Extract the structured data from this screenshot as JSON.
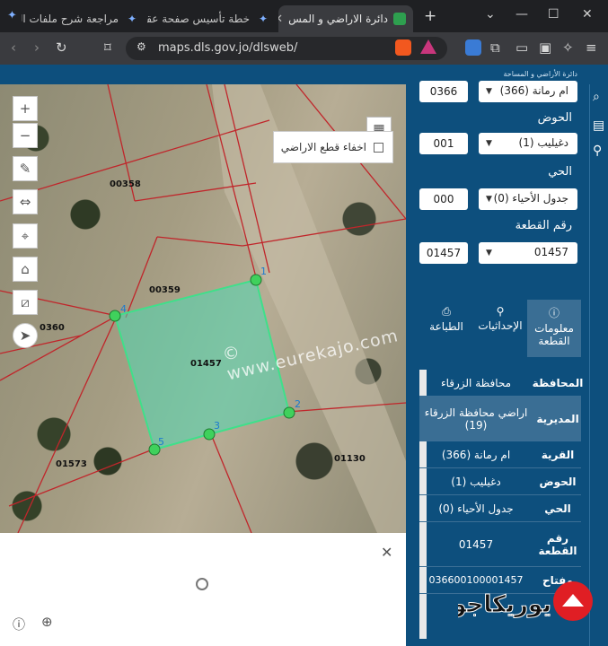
{
  "browser": {
    "tabs": [
      {
        "title": "مراجعة شرح ملفات الدرس",
        "color": "#6aa9ff"
      },
      {
        "title": "خطة تأسيس صفحة عقار",
        "color": "#6aa9ff"
      },
      {
        "title": "دائرة الاراضي و المس",
        "color": "#2e9f4f"
      }
    ],
    "new_tab": "+",
    "url": "maps.dls.gov.jo/dlsweb/"
  },
  "app": {
    "header_text": "دائرة الأراضي و المساحة",
    "map": {
      "hide_parcels_label": "اخفاء قطع الاراضي",
      "parcel_labels": [
        "00358",
        "00359",
        "0360",
        "01457",
        "01573",
        "01130"
      ],
      "vertex_labels": [
        "1",
        "2",
        "3",
        "4",
        "5"
      ],
      "watermark": "© www.eurekajo.com"
    },
    "form": {
      "top_select": "ام رمانة (366)",
      "top_num": "0366",
      "basin_label": "الحوض",
      "basin_select": "دغيليب (1)",
      "basin_num": "001",
      "district_label": "الحي",
      "district_select": "جدول الأحياء (0)",
      "district_num": "000",
      "plot_label": "رقم القطعة",
      "plot_select": "01457",
      "plot_num": "01457"
    },
    "tabs": [
      {
        "label": "معلومات القطعة",
        "icon": "ⓘ"
      },
      {
        "label": "الإحداثيات",
        "icon": "⚲"
      },
      {
        "label": "الطباعة",
        "icon": "⎙"
      }
    ],
    "details": [
      {
        "key": "المحافظة",
        "value": "محافظة الزرقاء"
      },
      {
        "key": "المديرية",
        "value": "اراضي محافظة الزرقاء (19)"
      },
      {
        "key": "القرية",
        "value": "ام رمانة (366)"
      },
      {
        "key": "الحوض",
        "value": "دغيليب (1)"
      },
      {
        "key": "الحي",
        "value": "جدول الأحياء (0)"
      },
      {
        "key": "رقم القطعة",
        "value": "01457"
      },
      {
        "key": "مفتاح",
        "value": "036600100001457"
      }
    ],
    "logo_text": "يوريكاجو"
  }
}
